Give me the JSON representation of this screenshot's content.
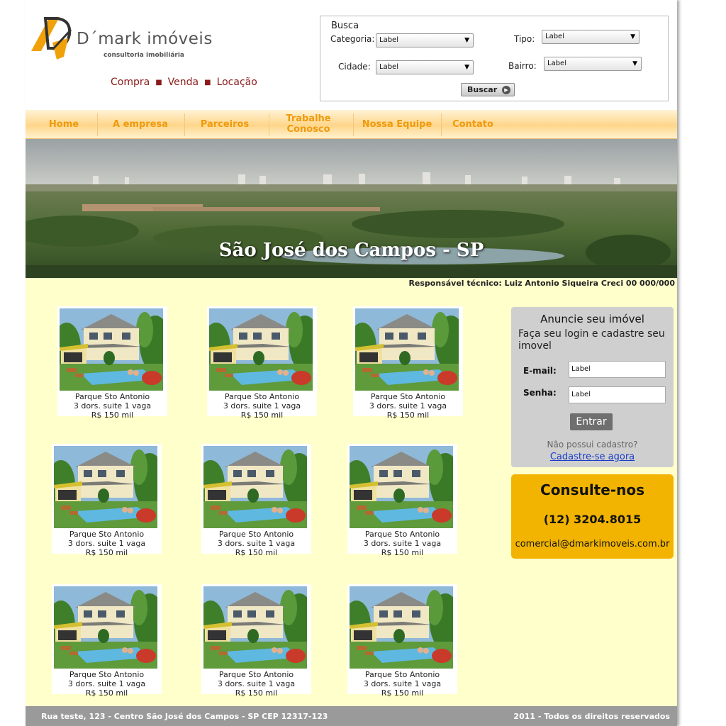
{
  "header": {
    "logo_text": "D´mark imóveis",
    "logo_subtitle": "consultoria imobiliária",
    "services": [
      "Compra",
      "Venda",
      "Locação"
    ]
  },
  "search": {
    "title": "Busca",
    "categoria_label": "Categoria:",
    "categoria_value": "Label",
    "tipo_label": "Tipo:",
    "tipo_value": "Label",
    "cidade_label": "Cidade:",
    "cidade_value": "Label",
    "bairro_label": "Bairro:",
    "bairro_value": "Label",
    "button_label": "Buscar"
  },
  "nav": {
    "items": [
      "Home",
      "A empresa",
      "Parceiros",
      "Trabalhe Conosco",
      "Nossa Equipe",
      "Contato"
    ]
  },
  "banner": {
    "title": "São José dos Campos - SP",
    "tecnico": "Responsável técnico: Luiz Antonio Siqueira Creci 00 000/000"
  },
  "listings": [
    {
      "name": "Parque Sto Antonio",
      "details": "3 dors. suite 1 vaga",
      "price": "R$ 150 mil"
    },
    {
      "name": "Parque Sto Antonio",
      "details": "3 dors. suite 1 vaga",
      "price": "R$ 150 mil"
    },
    {
      "name": "Parque Sto Antonio",
      "details": "3 dors. suite 1 vaga",
      "price": "R$ 150 mil"
    },
    {
      "name": "Parque Sto Antonio",
      "details": "3 dors. suite 1 vaga",
      "price": "R$ 150 mil"
    },
    {
      "name": "Parque Sto Antonio",
      "details": "3 dors. suite 1 vaga",
      "price": "R$ 150 mil"
    },
    {
      "name": "Parque Sto Antonio",
      "details": "3 dors. suite 1 vaga",
      "price": "R$ 150 mil"
    },
    {
      "name": "Parque Sto Antonio",
      "details": "3 dors. suite 1 vaga",
      "price": "R$ 150 mil"
    },
    {
      "name": "Parque Sto Antonio",
      "details": "3 dors. suite 1 vaga",
      "price": "R$ 150 mil"
    },
    {
      "name": "Parque Sto Antonio",
      "details": "3 dors. suite 1 vaga",
      "price": "R$ 150 mil"
    }
  ],
  "login": {
    "title": "Anuncie seu imóvel",
    "description": "Faça seu login e cadastre seu imovel",
    "email_label": "E-mail:",
    "email_value": "Label",
    "senha_label": "Senha:",
    "senha_value": "Label",
    "button_label": "Entrar",
    "no_account": "Não possui cadastro?",
    "register_link": "Cadastre-se agora"
  },
  "contact": {
    "title": "Consulte-nos",
    "phone": "(12) 3204.8015",
    "email": "comercial@dmarkimoveis.com.br"
  },
  "footer": {
    "address": "Rua teste, 123 - Centro São José dos Campos - SP CEP 12317-123",
    "copyright": "2011 - Todos os direitos reservados"
  },
  "colors": {
    "brand_orange": "#ef9a0c",
    "services_red": "#8b1a1a",
    "contact_yellow": "#f2b400",
    "page_background": "#ffffcc"
  }
}
